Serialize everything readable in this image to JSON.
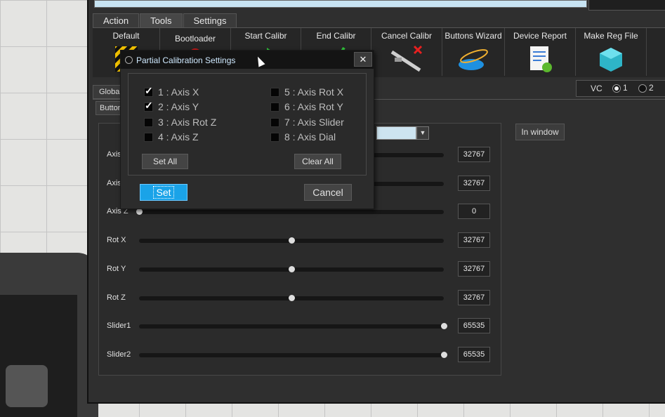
{
  "tabs": [
    "Action",
    "Tools",
    "Settings"
  ],
  "active_tab": "Tools",
  "ribbon": [
    {
      "label": "Default",
      "icon": "warning-stripes-icon"
    },
    {
      "label": "Bootloader",
      "icon": "bootloader-icon"
    },
    {
      "label": "Start Calibr",
      "icon": "start-arrow-icon"
    },
    {
      "label": "End Calibr",
      "icon": "checkmark-icon"
    },
    {
      "label": "Cancel Calibr",
      "icon": "caliper-cancel-icon"
    },
    {
      "label": "Buttons Wizard",
      "icon": "wizard-hat-icon"
    },
    {
      "label": "Device Report",
      "icon": "report-document-icon"
    },
    {
      "label": "Make Reg File",
      "icon": "registry-cube-icon"
    }
  ],
  "subtabs": {
    "global": "Globa",
    "button": "Button"
  },
  "vc": {
    "label": "VC",
    "options": [
      "1",
      "2"
    ],
    "selected": "1"
  },
  "in_window": "In window",
  "axes": [
    {
      "label": "Axis",
      "value": "32767",
      "position": 0.0
    },
    {
      "label": "Axis",
      "value": "32767",
      "position": 0.0
    },
    {
      "label": "Axis Z",
      "value": "0",
      "position": 0.0
    },
    {
      "label": "Rot X",
      "value": "32767",
      "position": 0.5
    },
    {
      "label": "Rot Y",
      "value": "32767",
      "position": 0.5
    },
    {
      "label": "Rot Z",
      "value": "32767",
      "position": 0.5
    },
    {
      "label": "Slider1",
      "value": "65535",
      "position": 1.0
    },
    {
      "label": "Slider2",
      "value": "65535",
      "position": 1.0
    }
  ],
  "dialog": {
    "title": "Partial Calibration Settings",
    "close": "✕",
    "checks_left": [
      {
        "label": "1 : Axis X",
        "checked": true
      },
      {
        "label": "2 : Axis Y",
        "checked": true
      },
      {
        "label": "3 : Axis Rot Z",
        "checked": false
      },
      {
        "label": "4 : Axis Z",
        "checked": false
      }
    ],
    "checks_right": [
      {
        "label": "5 : Axis Rot X",
        "checked": false
      },
      {
        "label": "6 : Axis Rot Y",
        "checked": false
      },
      {
        "label": "7 : Axis Slider",
        "checked": false
      },
      {
        "label": "8 : Axis Dial",
        "checked": false
      }
    ],
    "set_all": "Set All",
    "clear_all": "Clear All",
    "set": "Set",
    "cancel": "Cancel"
  },
  "colors": {
    "accent": "#1aa3e8",
    "app_bg": "#2f2f2f",
    "dialog_title_text": "#cfe9ff"
  }
}
